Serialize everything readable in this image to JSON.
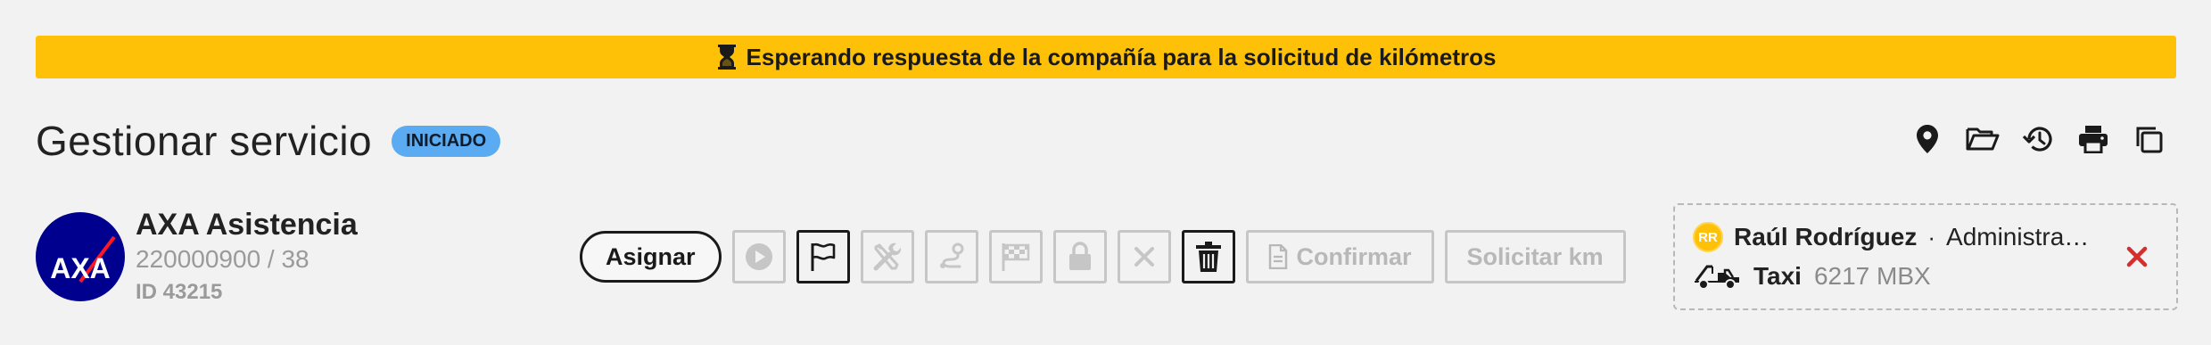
{
  "banner": {
    "icon": "hourglass-icon",
    "text": "Esperando respuesta de la compañía para la solicitud de kilómetros",
    "color": "#ffc107"
  },
  "header": {
    "title": "Gestionar servicio",
    "status": "INICIADO",
    "status_color": "#5aabf2",
    "tools": [
      "location-pin-icon",
      "folder-open-icon",
      "history-icon",
      "print-icon",
      "copy-icon"
    ]
  },
  "company": {
    "logo": "axa-logo",
    "name": "AXA Asistencia",
    "reference": "220000900 / 38",
    "id": "ID 43215"
  },
  "actions": {
    "assign_label": "Asignar",
    "icon_buttons": [
      {
        "name": "play-icon",
        "enabled": false
      },
      {
        "name": "flag-icon",
        "enabled": true
      },
      {
        "name": "tools-icon",
        "enabled": false
      },
      {
        "name": "route-icon",
        "enabled": false
      },
      {
        "name": "checkered-flag-icon",
        "enabled": false
      },
      {
        "name": "lock-icon",
        "enabled": false
      },
      {
        "name": "cancel-icon",
        "enabled": false
      },
      {
        "name": "trash-icon",
        "enabled": true
      }
    ],
    "confirm_label": "Confirmar",
    "request_km_label": "Solicitar km"
  },
  "assignee": {
    "initials": "RR",
    "name": "Raúl Rodríguez",
    "separator": "·",
    "role": "Administrador",
    "vehicle_icon": "tow-truck-icon",
    "vehicle_type": "Taxi",
    "plate": "6217 MBX",
    "remove_color": "#d32f2f"
  }
}
